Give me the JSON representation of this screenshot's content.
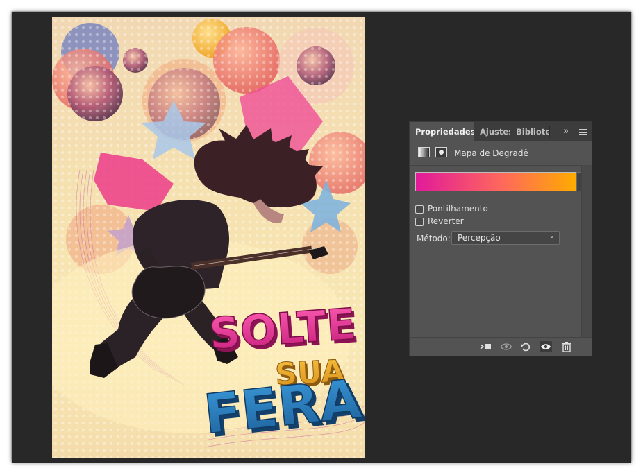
{
  "canvas": {
    "poster_title_line1": "SOLTE",
    "poster_title_line2": "SUA",
    "poster_title_line3": "FERA"
  },
  "properties_panel": {
    "tabs": [
      {
        "label": "Propriedades",
        "active": true
      },
      {
        "label": "Ajustes",
        "active": false
      },
      {
        "label": "Bibliotecas",
        "active": false
      }
    ],
    "overflow_glyph": "»",
    "adjustment_title": "Mapa de Degradê",
    "gradient": {
      "start_color": "#e11a9a",
      "mid_color": "#ff6a5a",
      "end_color": "#ffab00",
      "dropdown_glyph": "⌄"
    },
    "options": {
      "dither_label": "Pontilhamento",
      "dither_checked": false,
      "reverse_label": "Reverter",
      "reverse_checked": false
    },
    "method": {
      "label": "Método:",
      "value": "Percepção",
      "chevron": "⌄"
    },
    "footer_icons": [
      "clip-to-layer-icon",
      "view-previous-state-icon",
      "reset-icon",
      "visibility-eye-icon",
      "trash-icon"
    ]
  },
  "colors": {
    "workspace_bg": "#282828",
    "panel_bg": "#535353",
    "tabbar_bg": "#3c3c3c"
  }
}
